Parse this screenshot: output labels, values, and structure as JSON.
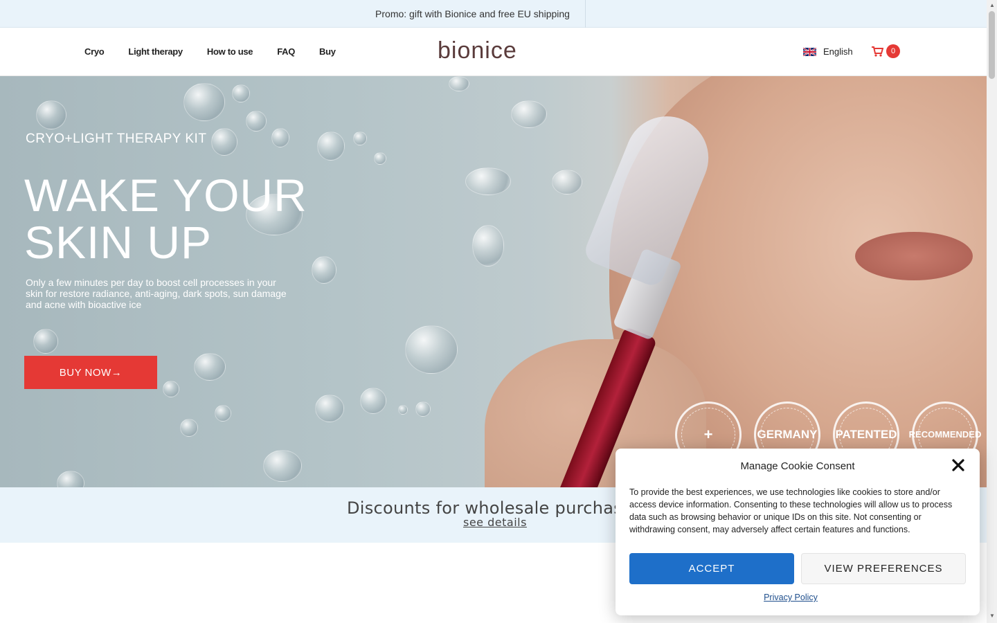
{
  "promo": {
    "text": "Promo: gift with Bionice and free EU shipping"
  },
  "header": {
    "nav": [
      "Cryo",
      "Light therapy",
      "How to use",
      "FAQ",
      "Buy"
    ],
    "logo": "bionice",
    "language": "English",
    "cart_count": "0"
  },
  "hero": {
    "subtitle": "CRYO+LIGHT THERAPY KIT",
    "title_line1": "WAKE YOUR",
    "title_line2": "SKIN UP",
    "description": "Only a few minutes per day to boost cell processes in your skin for restore radiance, anti-aging, dark spots, sun damage and acne with bioactive ice",
    "cta": "BUY NOW→",
    "badges": [
      "+",
      "GERMANY",
      "PATENTED",
      "RECOMMENDED"
    ]
  },
  "discount": {
    "title": "Discounts for wholesale purchas",
    "link": "see details"
  },
  "cookie": {
    "title": "Manage Cookie Consent",
    "body": "To provide the best experiences, we use technologies like cookies to store and/or access device information. Consenting to these technologies will allow us to process data such as browsing behavior or unique IDs on this site. Not consenting or withdrawing consent, may adversely affect certain features and functions.",
    "accept": "ACCEPT",
    "preferences": "VIEW PREFERENCES",
    "privacy": "Privacy Policy"
  },
  "colors": {
    "accent_red": "#e53935",
    "accept_blue": "#1e6fc9",
    "promo_bg": "#e9f3fa"
  }
}
